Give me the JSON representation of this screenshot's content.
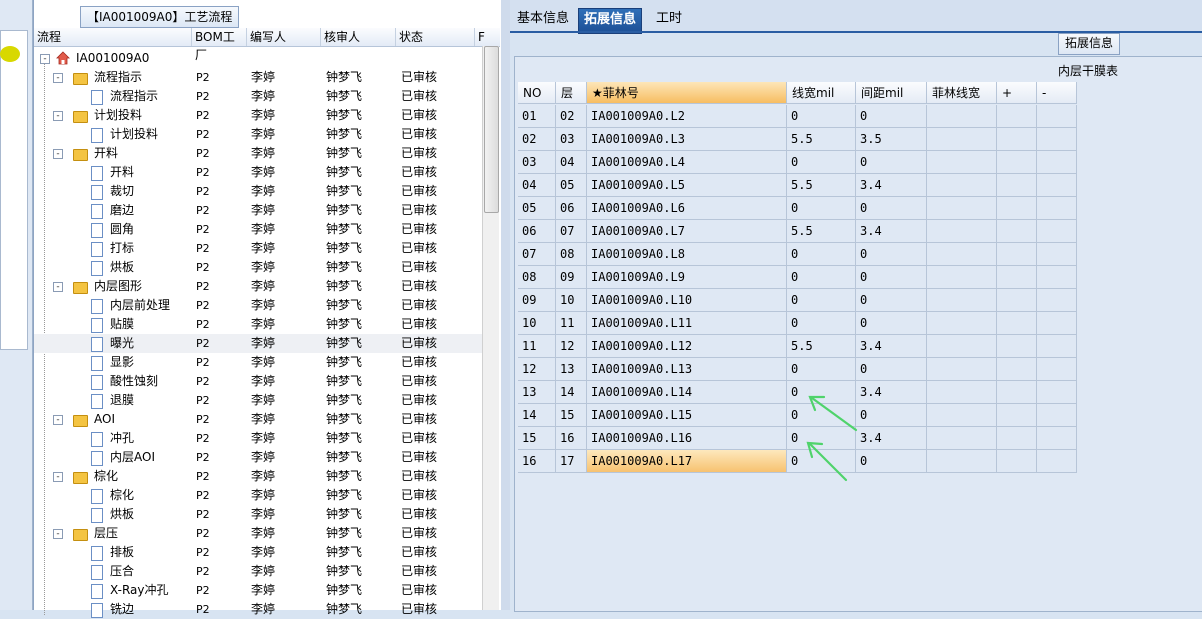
{
  "tree_panel": {
    "title": "【IA001009A0】工艺流程",
    "columns": [
      "流程",
      "BOM工厂",
      "编写人",
      "核审人",
      "状态",
      "F"
    ],
    "root": "IA001009A0",
    "rows": [
      {
        "label": "流程指示",
        "type": "folder",
        "level": 1,
        "bom": "P2",
        "writer": "李婷",
        "reviewer": "钟梦飞",
        "status": "已审核"
      },
      {
        "label": "流程指示",
        "type": "doc",
        "level": 2,
        "bom": "P2",
        "writer": "李婷",
        "reviewer": "钟梦飞",
        "status": "已审核"
      },
      {
        "label": "计划投料",
        "type": "folder",
        "level": 1,
        "bom": "P2",
        "writer": "李婷",
        "reviewer": "钟梦飞",
        "status": "已审核"
      },
      {
        "label": "计划投料",
        "type": "doc",
        "level": 2,
        "bom": "P2",
        "writer": "李婷",
        "reviewer": "钟梦飞",
        "status": "已审核"
      },
      {
        "label": "开料",
        "type": "folder",
        "level": 1,
        "bom": "P2",
        "writer": "李婷",
        "reviewer": "钟梦飞",
        "status": "已审核"
      },
      {
        "label": "开料",
        "type": "doc",
        "level": 2,
        "bom": "P2",
        "writer": "李婷",
        "reviewer": "钟梦飞",
        "status": "已审核"
      },
      {
        "label": "裁切",
        "type": "doc",
        "level": 2,
        "bom": "P2",
        "writer": "李婷",
        "reviewer": "钟梦飞",
        "status": "已审核"
      },
      {
        "label": "磨边",
        "type": "doc",
        "level": 2,
        "bom": "P2",
        "writer": "李婷",
        "reviewer": "钟梦飞",
        "status": "已审核"
      },
      {
        "label": "圆角",
        "type": "doc",
        "level": 2,
        "bom": "P2",
        "writer": "李婷",
        "reviewer": "钟梦飞",
        "status": "已审核"
      },
      {
        "label": "打标",
        "type": "doc",
        "level": 2,
        "bom": "P2",
        "writer": "李婷",
        "reviewer": "钟梦飞",
        "status": "已审核"
      },
      {
        "label": "烘板",
        "type": "doc",
        "level": 2,
        "bom": "P2",
        "writer": "李婷",
        "reviewer": "钟梦飞",
        "status": "已审核"
      },
      {
        "label": "内层图形",
        "type": "folder",
        "level": 1,
        "bom": "P2",
        "writer": "李婷",
        "reviewer": "钟梦飞",
        "status": "已审核"
      },
      {
        "label": "内层前处理",
        "type": "doc",
        "level": 2,
        "bom": "P2",
        "writer": "李婷",
        "reviewer": "钟梦飞",
        "status": "已审核"
      },
      {
        "label": "贴膜",
        "type": "doc",
        "level": 2,
        "bom": "P2",
        "writer": "李婷",
        "reviewer": "钟梦飞",
        "status": "已审核"
      },
      {
        "label": "曝光",
        "type": "doc",
        "level": 2,
        "bom": "P2",
        "writer": "李婷",
        "reviewer": "钟梦飞",
        "status": "已审核",
        "selected": true
      },
      {
        "label": "显影",
        "type": "doc",
        "level": 2,
        "bom": "P2",
        "writer": "李婷",
        "reviewer": "钟梦飞",
        "status": "已审核"
      },
      {
        "label": "酸性蚀刻",
        "type": "doc",
        "level": 2,
        "bom": "P2",
        "writer": "李婷",
        "reviewer": "钟梦飞",
        "status": "已审核"
      },
      {
        "label": "退膜",
        "type": "doc",
        "level": 2,
        "bom": "P2",
        "writer": "李婷",
        "reviewer": "钟梦飞",
        "status": "已审核"
      },
      {
        "label": "AOI",
        "type": "folder",
        "level": 1,
        "bom": "P2",
        "writer": "李婷",
        "reviewer": "钟梦飞",
        "status": "已审核"
      },
      {
        "label": "冲孔",
        "type": "doc",
        "level": 2,
        "bom": "P2",
        "writer": "李婷",
        "reviewer": "钟梦飞",
        "status": "已审核"
      },
      {
        "label": "内层AOI",
        "type": "doc",
        "level": 2,
        "bom": "P2",
        "writer": "李婷",
        "reviewer": "钟梦飞",
        "status": "已审核"
      },
      {
        "label": "棕化",
        "type": "folder",
        "level": 1,
        "bom": "P2",
        "writer": "李婷",
        "reviewer": "钟梦飞",
        "status": "已审核"
      },
      {
        "label": "棕化",
        "type": "doc",
        "level": 2,
        "bom": "P2",
        "writer": "李婷",
        "reviewer": "钟梦飞",
        "status": "已审核"
      },
      {
        "label": "烘板",
        "type": "doc",
        "level": 2,
        "bom": "P2",
        "writer": "李婷",
        "reviewer": "钟梦飞",
        "status": "已审核"
      },
      {
        "label": "层压",
        "type": "folder",
        "level": 1,
        "bom": "P2",
        "writer": "李婷",
        "reviewer": "钟梦飞",
        "status": "已审核"
      },
      {
        "label": "排板",
        "type": "doc",
        "level": 2,
        "bom": "P2",
        "writer": "李婷",
        "reviewer": "钟梦飞",
        "status": "已审核"
      },
      {
        "label": "压合",
        "type": "doc",
        "level": 2,
        "bom": "P2",
        "writer": "李婷",
        "reviewer": "钟梦飞",
        "status": "已审核"
      },
      {
        "label": "X-Ray冲孔",
        "type": "doc",
        "level": 2,
        "bom": "P2",
        "writer": "李婷",
        "reviewer": "钟梦飞",
        "status": "已审核"
      },
      {
        "label": "铣边",
        "type": "doc",
        "level": 2,
        "bom": "P2",
        "writer": "李婷",
        "reviewer": "钟梦飞",
        "status": "已审核"
      }
    ]
  },
  "tabs": [
    {
      "label": "基本信息",
      "active": false
    },
    {
      "label": "拓展信息",
      "active": true
    },
    {
      "label": "工时",
      "active": false
    }
  ],
  "ext_button": "拓展信息",
  "grid": {
    "caption": "内层干膜表",
    "columns": [
      "NO",
      "层",
      "★菲林号",
      "线宽mil",
      "间距mil",
      "菲林线宽",
      "+",
      "-"
    ],
    "rows": [
      [
        "01",
        "02",
        "IA001009A0.L2",
        "0",
        "0"
      ],
      [
        "02",
        "03",
        "IA001009A0.L3",
        "5.5",
        "3.5"
      ],
      [
        "03",
        "04",
        "IA001009A0.L4",
        "0",
        "0"
      ],
      [
        "04",
        "05",
        "IA001009A0.L5",
        "5.5",
        "3.4"
      ],
      [
        "05",
        "06",
        "IA001009A0.L6",
        "0",
        "0"
      ],
      [
        "06",
        "07",
        "IA001009A0.L7",
        "5.5",
        "3.4"
      ],
      [
        "07",
        "08",
        "IA001009A0.L8",
        "0",
        "0"
      ],
      [
        "08",
        "09",
        "IA001009A0.L9",
        "0",
        "0"
      ],
      [
        "09",
        "10",
        "IA001009A0.L10",
        "0",
        "0"
      ],
      [
        "10",
        "11",
        "IA001009A0.L11",
        "0",
        "0"
      ],
      [
        "11",
        "12",
        "IA001009A0.L12",
        "5.5",
        "3.4"
      ],
      [
        "12",
        "13",
        "IA001009A0.L13",
        "0",
        "0"
      ],
      [
        "13",
        "14",
        "IA001009A0.L14",
        "0",
        "3.4"
      ],
      [
        "14",
        "15",
        "IA001009A0.L15",
        "0",
        "0"
      ],
      [
        "15",
        "16",
        "IA001009A0.L16",
        "0",
        "3.4"
      ],
      [
        "16",
        "17",
        "IA001009A0.L17",
        "0",
        "0"
      ]
    ],
    "selected_row": 15
  },
  "colors": {
    "tab_active": "#1c4f96",
    "annotation_arrow": "#4fd36b",
    "selection": "#f7c270"
  }
}
